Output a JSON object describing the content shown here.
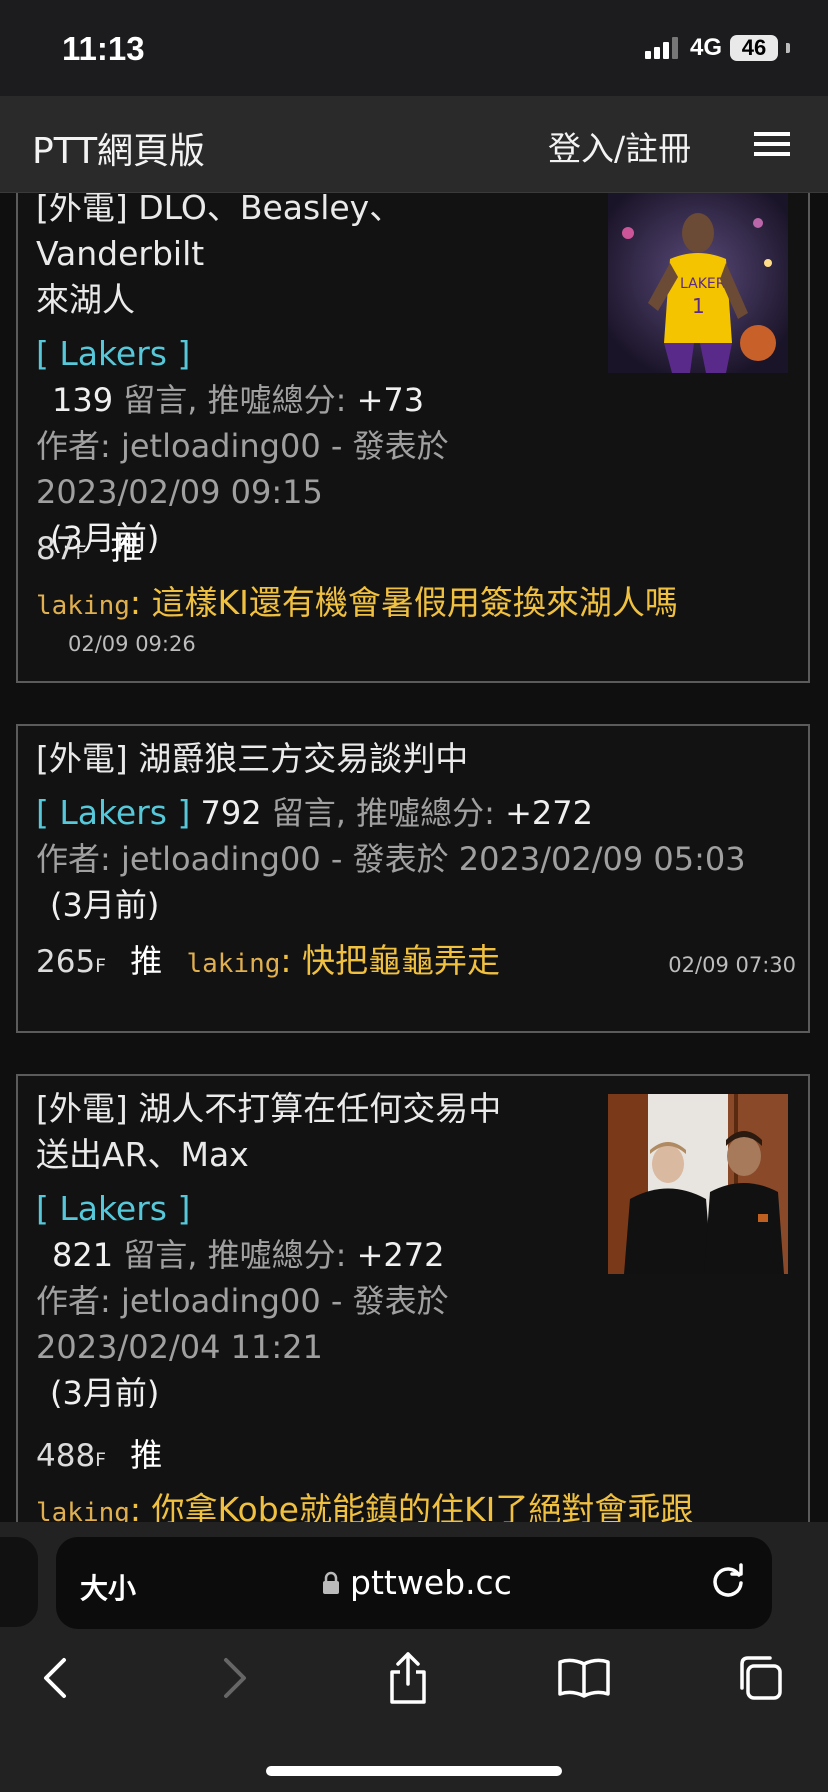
{
  "status": {
    "time": "11:13",
    "network": "4G",
    "battery": "46"
  },
  "header": {
    "title": "PTT網頁版",
    "login": "登入/註冊"
  },
  "cards": [
    {
      "title_line1": "[外電] DLO、Beasley、Vanderbilt",
      "title_line2": "來湖人",
      "board": "[ Lakers ]",
      "comment_count": "139",
      "comment_label": "留言, 推噓總分:",
      "score": "+73",
      "author_prefix": "作者:",
      "author": "jetloading00",
      "posted_label": "- 發表於",
      "posted_at": "2023/02/09 09:15",
      "ago": "(3月前)",
      "floor": "87",
      "floor_suffix": "F",
      "push": "推",
      "commenter": "laking",
      "comment": ": 這樣KI還有機會暑假用簽換來湖人嗎",
      "comment_time": "02/09 09:26",
      "thumb_icon": "laker-player-photo"
    },
    {
      "title": "[外電] 湖爵狼三方交易談判中",
      "board": "[ Lakers ]",
      "comment_count": "792",
      "comment_label": "留言, 推噓總分:",
      "score": "+272",
      "author_prefix": "作者:",
      "author": "jetloading00",
      "posted_label": "- 發表於",
      "posted_at": "2023/02/09 05:03",
      "ago": "(3月前)",
      "floor": "265",
      "floor_suffix": "F",
      "push": "推",
      "commenter": "laking",
      "comment": ": 快把龜龜弄走",
      "comment_time": "02/09 07:30"
    },
    {
      "title_line1": "[外電] 湖人不打算在任何交易中",
      "title_line2": "送出AR、Max",
      "board": "[ Lakers ]",
      "comment_count": "821",
      "comment_label": "留言, 推噓總分:",
      "score": "+272",
      "author_prefix": "作者:",
      "author": "jetloading00",
      "posted_label": "- 發表於",
      "posted_at": "2023/02/04 11:21",
      "ago": "(3月前)",
      "floor": "488",
      "floor_suffix": "F",
      "push": "推",
      "commenter": "laking",
      "comment": ": 你拿Kobe就能鎮的住KI了絕對會乖跟",
      "thumb_icon": "two-players-photo"
    }
  ],
  "browser": {
    "text_size": "大小",
    "url": "pttweb.cc"
  }
}
